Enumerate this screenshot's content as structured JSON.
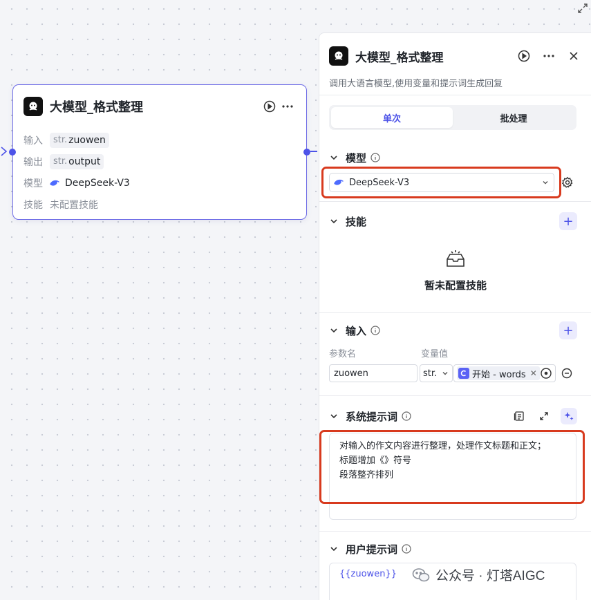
{
  "node": {
    "title": "大模型_格式整理",
    "rows": {
      "input_label": "输入",
      "input_type": "str.",
      "input_value": "zuowen",
      "output_label": "输出",
      "output_type": "str.",
      "output_value": "output",
      "model_label": "模型",
      "model_value": "DeepSeek-V3",
      "skill_label": "技能",
      "skill_value": "未配置技能"
    }
  },
  "panel": {
    "title": "大模型_格式整理",
    "description": "调用大语言模型,使用变量和提示词生成回复",
    "tabs": [
      "单次",
      "批处理"
    ],
    "model_section": {
      "title": "模型",
      "selected": "DeepSeek-V3"
    },
    "skill_section": {
      "title": "技能",
      "empty_text": "暂未配置技能"
    },
    "input_section": {
      "title": "输入",
      "col_param": "参数名",
      "col_value": "变量值",
      "param_name": "zuowen",
      "type": "str.",
      "ref_text": "开始 - words"
    },
    "system_prompt": {
      "title": "系统提示词",
      "lines": [
        "对输入的作文内容进行整理，处理作文标题和正文；",
        "标题增加《》符号",
        "段落整齐排列"
      ]
    },
    "user_prompt": {
      "title": "用户提示词",
      "value": "{{zuowen}}"
    }
  },
  "watermark": {
    "text": "公众号 · 灯塔AIGC"
  },
  "colors": {
    "accent": "#4d53e8",
    "highlight": "#d83a1e"
  }
}
